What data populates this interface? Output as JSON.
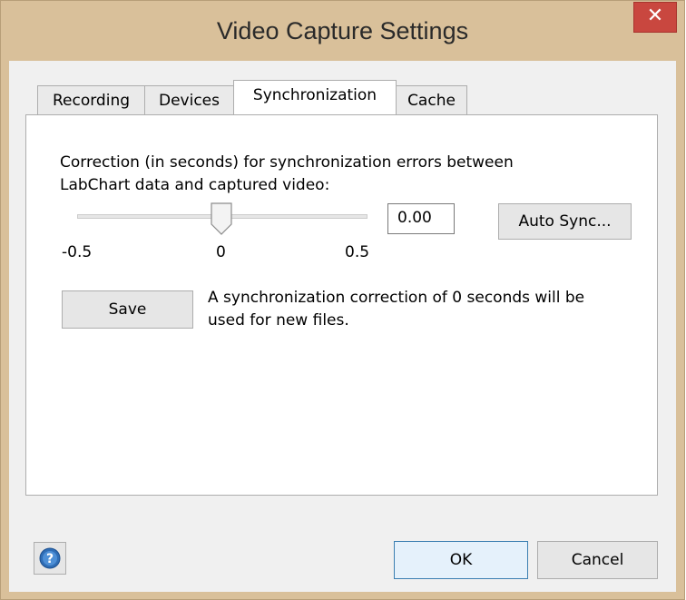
{
  "window": {
    "title": "Video Capture Settings",
    "close_glyph": "✕"
  },
  "tabs": [
    {
      "label": "Recording"
    },
    {
      "label": "Devices"
    },
    {
      "label": "Synchronization"
    },
    {
      "label": "Cache"
    }
  ],
  "sync": {
    "description_line1": "Correction (in seconds) for synchronization errors between",
    "description_line2": "LabChart data and captured video:",
    "slider": {
      "min_label": "-0.5",
      "mid_label": "0",
      "max_label": "0.5",
      "value": 0.0
    },
    "value_field": "0.00",
    "auto_sync_label": "Auto Sync...",
    "save_label": "Save",
    "status_line1": "A synchronization correction of 0 seconds will be",
    "status_line2": "used for new files."
  },
  "footer": {
    "ok_label": "OK",
    "cancel_label": "Cancel",
    "help_icon": "help-icon"
  }
}
